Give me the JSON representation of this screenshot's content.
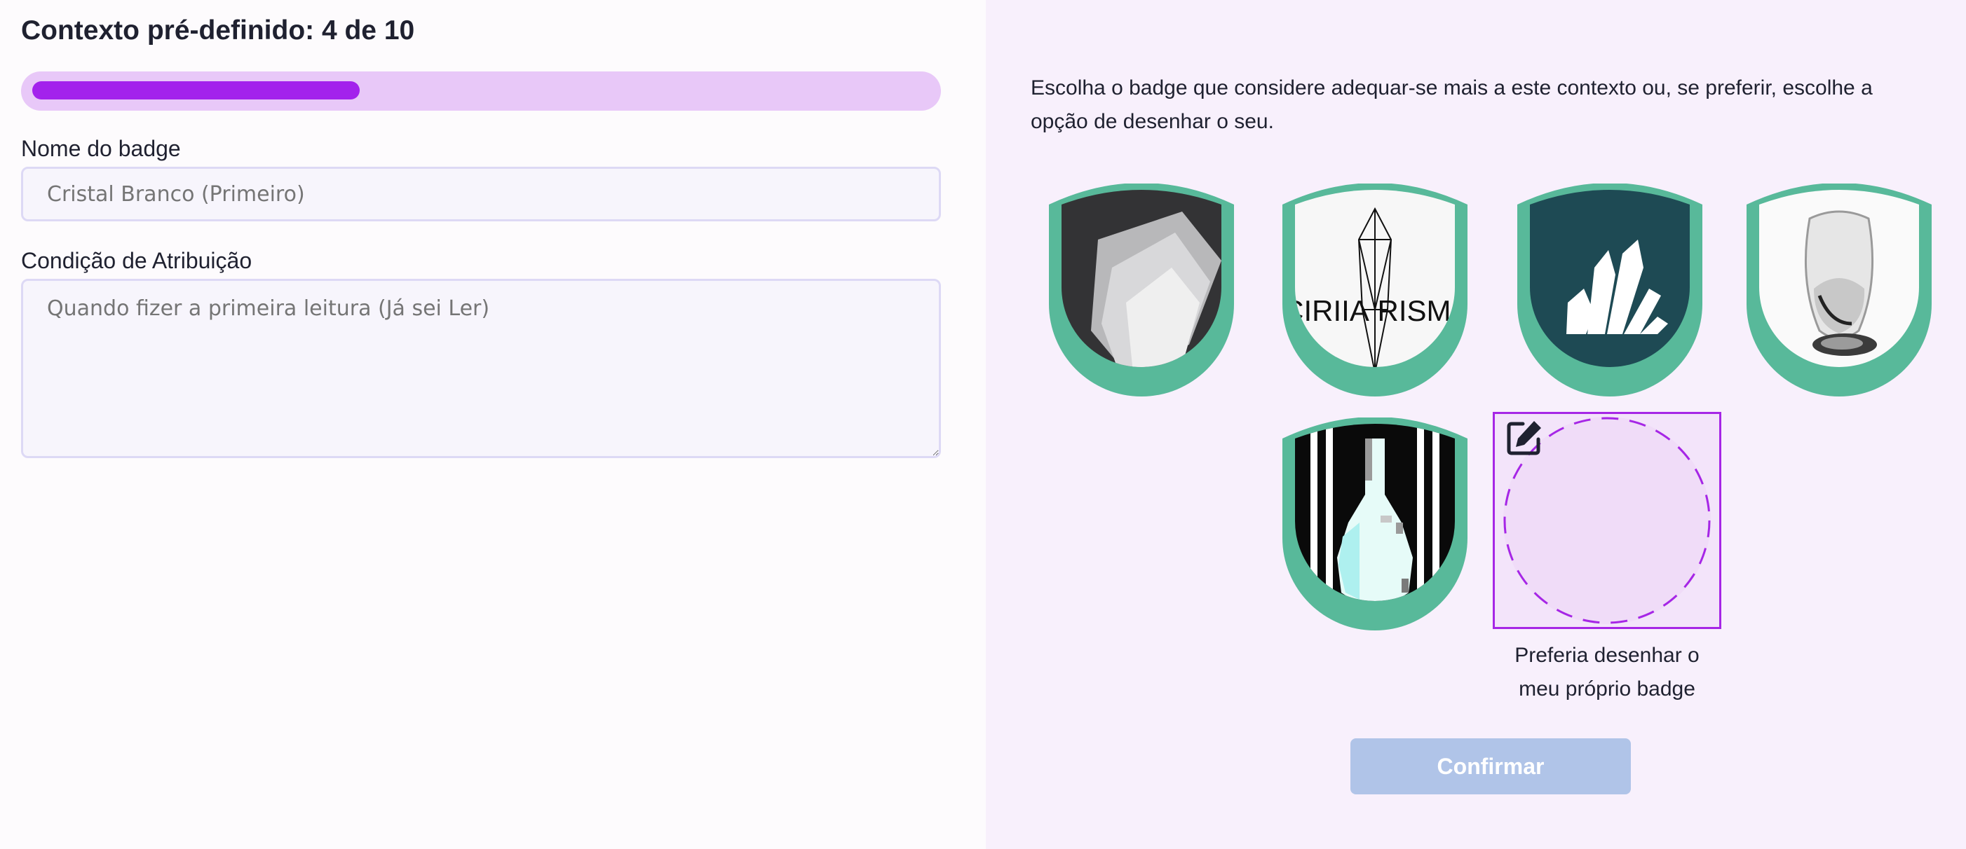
{
  "context": {
    "title": "Contexto pré-definido: 4 de 10",
    "current": 4,
    "total": 10,
    "progress_fraction": 0.365
  },
  "form": {
    "name_label": "Nome do badge",
    "name_placeholder": "Cristal Branco (Primeiro)",
    "condition_label": "Condição de Atribuição",
    "condition_placeholder": "Quando fizer a primeira leitura (Já sei Ler)"
  },
  "instructions": "Escolha o badge que considere adequar-se mais a este contexto ou, se preferir, escolhe a opção de desenhar o seu.",
  "badges": [
    {
      "icon": "white-crystal-rock-photo-icon"
    },
    {
      "icon": "prism-crystal-logo-icon",
      "text_left": "CIRIIA",
      "text_right": "RISMA"
    },
    {
      "icon": "white-crystals-on-teal-icon"
    },
    {
      "icon": "glass-tumbler-photo-icon"
    },
    {
      "icon": "pixel-crystal-drop-icon"
    }
  ],
  "draw_option": {
    "icon": "edit-pencil-icon",
    "caption_line1": "Preferia desenhar o",
    "caption_line2": "meu próprio badge"
  },
  "confirm_label": "Confirmar",
  "colors": {
    "accent": "#a322ec",
    "progress_track": "#e8c8f8",
    "badge_frame": "#58b99a",
    "right_panel_bg": "#f8f0fc",
    "confirm_disabled": "#b0c4e8"
  }
}
